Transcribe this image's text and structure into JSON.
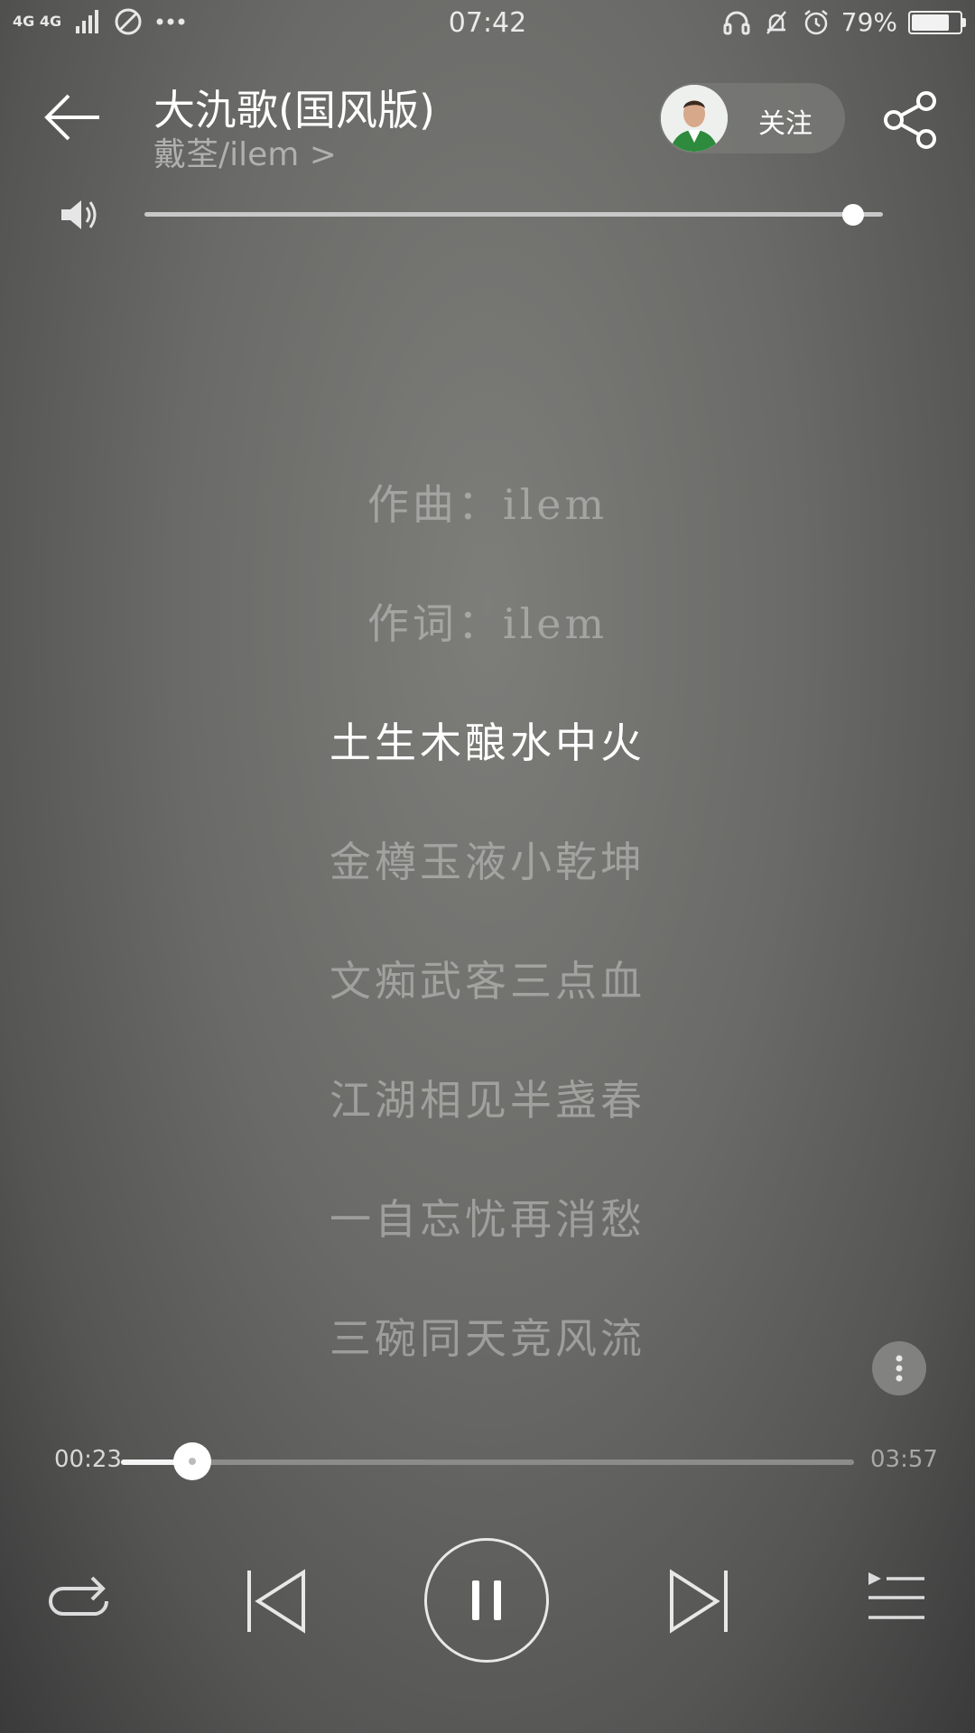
{
  "status_bar": {
    "network": "4G 4G",
    "time": "07:42",
    "battery_percent": "79%",
    "battery_level": 0.79,
    "left_icons": [
      "signal-icon",
      "no-disturb-icon",
      "more-dots-icon"
    ],
    "right_icons": [
      "headset-icon",
      "bell-off-icon",
      "alarm-icon",
      "battery-icon"
    ]
  },
  "header": {
    "song_title": "大氿歌(国风版)",
    "artist": "戴荃/ilem >",
    "follow_label": "关注"
  },
  "volume": {
    "level": 0.96
  },
  "lyrics": {
    "lines": [
      "作曲：ilem",
      "作词：ilem",
      "土生木酿水中火",
      "金樽玉液小乾坤",
      "文痴武客三点血",
      "江湖相见半盏春",
      "一自忘忧再消愁",
      "三碗同天竞风流"
    ],
    "active_index": 2
  },
  "progress": {
    "current": "00:23",
    "total": "03:57",
    "fraction": 0.097
  },
  "controls": {
    "repeat": "repeat-icon",
    "prev": "previous-icon",
    "play_pause": "pause-icon",
    "next": "next-icon",
    "playlist": "playlist-icon"
  },
  "colors": {
    "accent": "#ffffff",
    "inactive_lyric": "#c8c8c6",
    "background": "#6a6a68"
  }
}
